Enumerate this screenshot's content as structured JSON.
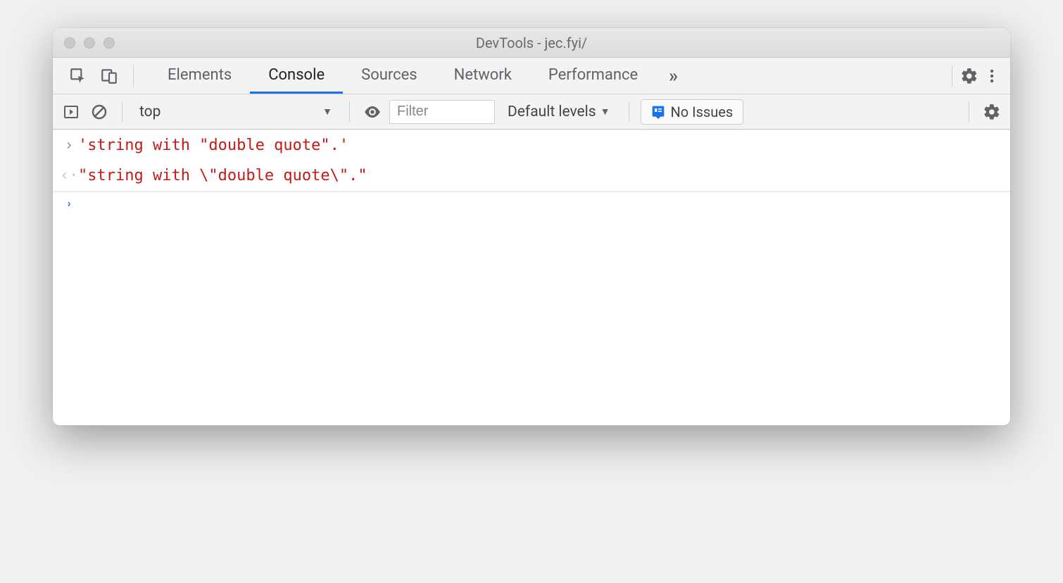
{
  "window": {
    "title": "DevTools - jec.fyi/"
  },
  "tabs": {
    "items": [
      "Elements",
      "Console",
      "Sources",
      "Network",
      "Performance"
    ],
    "active_index": 1,
    "more_glyph": "»"
  },
  "toolbar": {
    "context_label": "top",
    "filter_placeholder": "Filter",
    "filter_value": "",
    "levels_label": "Default levels",
    "issues_label": "No Issues"
  },
  "console": {
    "rows": [
      {
        "kind": "input",
        "text": "'string with \"double quote\".'"
      },
      {
        "kind": "output",
        "text": "\"string with \\\"double quote\\\".\""
      }
    ]
  }
}
